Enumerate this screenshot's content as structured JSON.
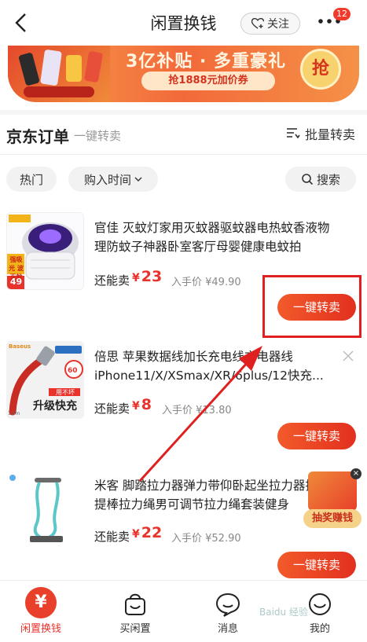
{
  "header": {
    "title": "闲置换钱",
    "follow_label": "关注",
    "badge_count": "12"
  },
  "banner": {
    "title": "3亿补贴 · 多重豪礼",
    "coupon": "抢1888元加价券",
    "grab": "抢"
  },
  "section": {
    "title": "京东订单",
    "subtitle": "一键转卖",
    "batch_label": "批量转卖"
  },
  "filters": {
    "hot": "热门",
    "purchase_time": "购入时间",
    "search": "搜索"
  },
  "thumb_texts": {
    "item1_badge": "强吸光 波灭蚊",
    "item1_price": "49",
    "item2_brand": "Baseus",
    "item2_tag": "用不坏",
    "item2_big": "升级快充",
    "item2_badge": "60"
  },
  "items": [
    {
      "title": "官佳 灭蚊灯家用灭蚊器驱蚊器电热蚊香液物理防蚊子神器卧室客厅母婴健康电蚊拍",
      "can_sell": "还能卖",
      "currency": "¥",
      "price": "23",
      "buy_price": "入手价 ¥49.90",
      "sell_label": "一键转卖"
    },
    {
      "title": "倍思 苹果数据线加长充电线充电器线iPhone11/X/XSmax/XR/6plus/12快充...",
      "can_sell": "还能卖",
      "currency": "¥",
      "price": "8",
      "buy_price": "入手价 ¥13.80",
      "sell_label": "一键转卖"
    },
    {
      "title": "米客 脚踏拉力器弹力带仰卧起坐拉力器拉提棒拉力绳男可调节拉力绳套装健身",
      "can_sell": "还能卖",
      "currency": "¥",
      "price": "22",
      "buy_price": "入手价 ¥52.90",
      "sell_label": "一键转卖"
    }
  ],
  "float_widget": {
    "label": "抽奖赚钱",
    "close": "×"
  },
  "tabs": [
    {
      "label": "闲置换钱",
      "active": true
    },
    {
      "label": "买闲置",
      "active": false
    },
    {
      "label": "消息",
      "active": false
    },
    {
      "label": "我的",
      "active": false
    }
  ],
  "tab_active_glyph": "¥",
  "watermark": "Baidu 经验",
  "colors": {
    "accent": "#e8322b",
    "highlight": "#e02020"
  }
}
